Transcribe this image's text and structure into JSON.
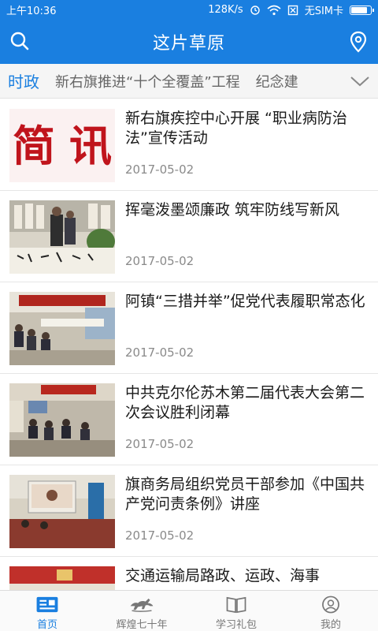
{
  "status": {
    "time": "上午10:36",
    "speed": "128K/s",
    "sim": "无SIM卡",
    "battery_level": 0.9
  },
  "header": {
    "title": "这片草原",
    "left_icon": "search-icon",
    "right_icon": "location-pin-icon"
  },
  "tabs": [
    {
      "label": "时政"
    },
    {
      "label": "新右旗推进“十个全覆盖”工程"
    },
    {
      "label": "纪念建"
    }
  ],
  "news": [
    {
      "title": "新右旗疾控中心开展 “职业病防治法”宣传活动",
      "date": "2017-05-02",
      "thumb_text": "简 讯"
    },
    {
      "title": "挥毫泼墨颂廉政  筑牢防线写新风",
      "date": "2017-05-02"
    },
    {
      "title": "阿镇“三措并举”促党代表履职常态化",
      "date": "2017-05-02"
    },
    {
      "title": "中共克尔伦苏木第二届代表大会第二次会议胜利闭幕",
      "date": "2017-05-02"
    },
    {
      "title": "旗商务局组织党员干部参加《中国共产党问责条例》讲座",
      "date": "2017-05-02"
    },
    {
      "title": "交通运输局路政、运政、海事",
      "date": ""
    }
  ],
  "bottom_nav": [
    {
      "label": "首页",
      "icon": "home-news-icon",
      "active": true
    },
    {
      "label": "辉煌七十年",
      "icon": "horse-icon",
      "active": false
    },
    {
      "label": "学习礼包",
      "icon": "book-icon",
      "active": false
    },
    {
      "label": "我的",
      "icon": "profile-icon",
      "active": false
    }
  ],
  "colors": {
    "accent": "#1a7fe0",
    "thumb_red": "#c0141c"
  }
}
